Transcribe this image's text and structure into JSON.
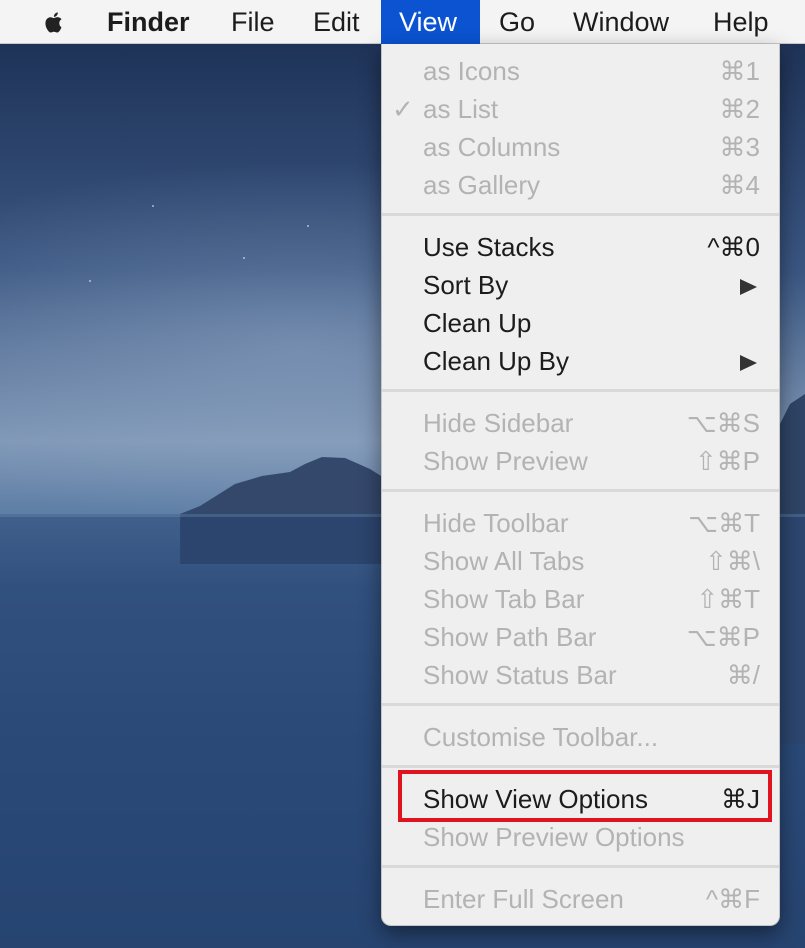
{
  "menubar": {
    "apple_icon": "apple-logo-icon",
    "items": [
      "Finder",
      "File",
      "Edit",
      "View",
      "Go",
      "Window",
      "Help"
    ],
    "active": "View"
  },
  "view_menu": {
    "items": [
      {
        "label": "as Icons",
        "shortcut": "⌘1",
        "enabled": false,
        "checked": false
      },
      {
        "label": "as List",
        "shortcut": "⌘2",
        "enabled": false,
        "checked": true,
        "check_glyph": "✓"
      },
      {
        "label": "as Columns",
        "shortcut": "⌘3",
        "enabled": false,
        "checked": false
      },
      {
        "label": "as Gallery",
        "shortcut": "⌘4",
        "enabled": false,
        "checked": false
      },
      {
        "label": "Use Stacks",
        "shortcut": "^⌘0",
        "enabled": true
      },
      {
        "label": "Sort By",
        "submenu": true,
        "enabled": true
      },
      {
        "label": "Clean Up",
        "enabled": true
      },
      {
        "label": "Clean Up By",
        "submenu": true,
        "enabled": true
      },
      {
        "label": "Hide Sidebar",
        "shortcut": "⌥⌘S",
        "enabled": false
      },
      {
        "label": "Show Preview",
        "shortcut": "⇧⌘P",
        "enabled": false
      },
      {
        "label": "Hide Toolbar",
        "shortcut": "⌥⌘T",
        "enabled": false
      },
      {
        "label": "Show All Tabs",
        "shortcut": "⇧⌘\\",
        "enabled": false
      },
      {
        "label": "Show Tab Bar",
        "shortcut": "⇧⌘T",
        "enabled": false
      },
      {
        "label": "Show Path Bar",
        "shortcut": "⌥⌘P",
        "enabled": false
      },
      {
        "label": "Show Status Bar",
        "shortcut": "⌘/",
        "enabled": false
      },
      {
        "label": "Customise Toolbar...",
        "enabled": false
      },
      {
        "label": "Show View Options",
        "shortcut": "⌘J",
        "enabled": true,
        "highlighted": true
      },
      {
        "label": "Show Preview Options",
        "enabled": false
      },
      {
        "label": "Enter Full Screen",
        "shortcut": "^⌘F",
        "enabled": false
      }
    ]
  },
  "colors": {
    "menubar_active": "#0b53d1",
    "highlight_box": "#e0141e",
    "disabled_text": "#b3b3b3"
  }
}
